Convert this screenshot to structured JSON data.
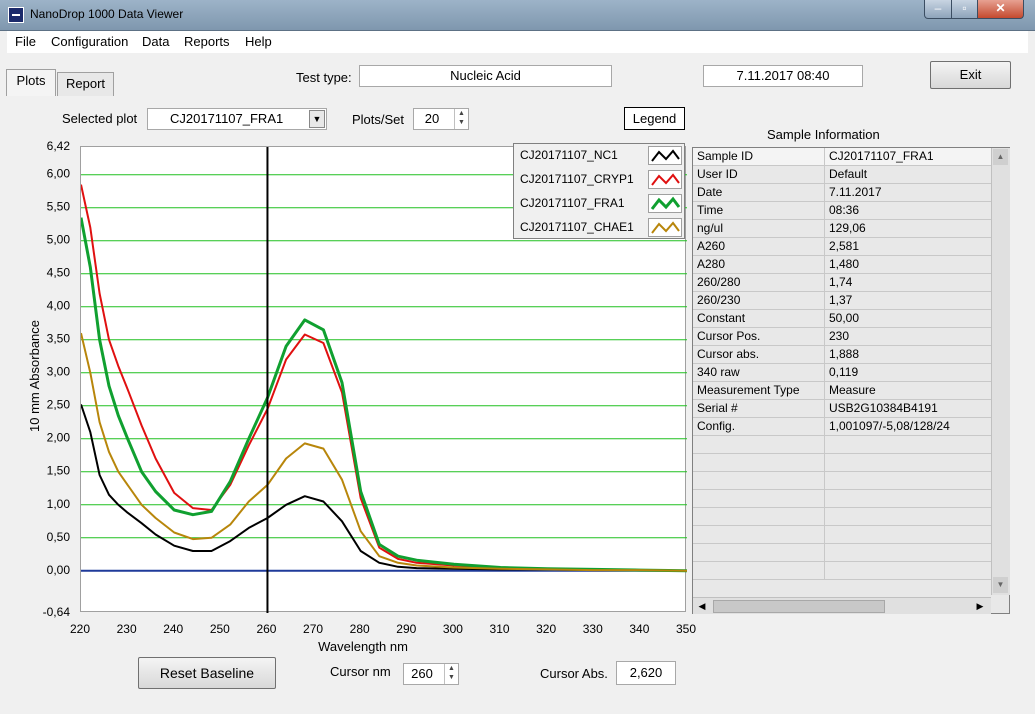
{
  "titlebar": {
    "title": "NanoDrop 1000 Data Viewer",
    "min_label": "–",
    "max_label": "▫",
    "close_label": "✕"
  },
  "menu": [
    {
      "label": "File"
    },
    {
      "label": "Configuration"
    },
    {
      "label": "Data"
    },
    {
      "label": "Reports"
    },
    {
      "label": "Help"
    }
  ],
  "tabs": [
    {
      "label": "Plots"
    },
    {
      "label": "Report"
    }
  ],
  "test_type": {
    "label": "Test type:",
    "value": "Nucleic Acid"
  },
  "datetime": "7.11.2017  08:40",
  "exit_label": "Exit",
  "selected_plot": {
    "label": "Selected plot",
    "value": "CJ20171107_FRA1"
  },
  "plots_per_set": {
    "label": "Plots/Set",
    "value": "20"
  },
  "legend_button": "Legend",
  "sample_info_title": "Sample Information",
  "sample_info": [
    {
      "key": "Sample ID",
      "value": "CJ20171107_FRA1"
    },
    {
      "key": "User ID",
      "value": "Default"
    },
    {
      "key": "Date",
      "value": "7.11.2017"
    },
    {
      "key": "Time",
      "value": "08:36"
    },
    {
      "key": "ng/ul",
      "value": "129,06"
    },
    {
      "key": "A260",
      "value": " 2,581"
    },
    {
      "key": "A280",
      "value": " 1,480"
    },
    {
      "key": "260/280",
      "value": " 1,74"
    },
    {
      "key": "260/230",
      "value": " 1,37"
    },
    {
      "key": "Constant",
      "value": "50,00"
    },
    {
      "key": "Cursor Pos.",
      "value": "230"
    },
    {
      "key": "Cursor abs.",
      "value": "1,888"
    },
    {
      "key": "340 raw",
      "value": " 0,119"
    },
    {
      "key": "Measurement Type",
      "value": "Measure"
    },
    {
      "key": "Serial #",
      "value": "USB2G10384B4191"
    },
    {
      "key": "Config.",
      "value": "1,001097/-5,08/128/24"
    }
  ],
  "reset_baseline": "Reset Baseline",
  "cursor_nm": {
    "label": "Cursor nm",
    "value": "260"
  },
  "cursor_abs": {
    "label": "Cursor Abs.",
    "value": "2,620"
  },
  "chart_data": {
    "type": "line",
    "xlabel": "Wavelength nm",
    "ylabel": "10 mm Absorbance",
    "xlim": [
      220,
      350
    ],
    "ylim": [
      -0.64,
      6.42
    ],
    "x_ticks": [
      "220",
      "230",
      "240",
      "250",
      "260",
      "270",
      "280",
      "290",
      "300",
      "310",
      "320",
      "330",
      "340",
      "350"
    ],
    "y_ticks": [
      {
        "v": 6.42,
        "label": "6,42"
      },
      {
        "v": 6.0,
        "label": "6,00"
      },
      {
        "v": 5.5,
        "label": "5,50"
      },
      {
        "v": 5.0,
        "label": "5,00"
      },
      {
        "v": 4.5,
        "label": "4,50"
      },
      {
        "v": 4.0,
        "label": "4,00"
      },
      {
        "v": 3.5,
        "label": "3,50"
      },
      {
        "v": 3.0,
        "label": "3,00"
      },
      {
        "v": 2.5,
        "label": "2,50"
      },
      {
        "v": 2.0,
        "label": "2,00"
      },
      {
        "v": 1.5,
        "label": "1,50"
      },
      {
        "v": 1.0,
        "label": "1,00"
      },
      {
        "v": 0.5,
        "label": "0,50"
      },
      {
        "v": 0.0,
        "label": "0,00"
      },
      {
        "v": -0.64,
        "label": "-0,64"
      }
    ],
    "grid": true,
    "cursor_x": 260,
    "baseline_color": "#1f3a9a",
    "x": [
      220,
      222,
      224,
      226,
      228,
      230,
      233,
      236,
      240,
      244,
      248,
      252,
      256,
      260,
      264,
      268,
      272,
      276,
      280,
      284,
      288,
      292,
      300,
      310,
      320,
      330,
      340,
      350
    ],
    "series": [
      {
        "name": "CJ20171107_NC1",
        "color": "#000000",
        "values": [
          2.52,
          2.1,
          1.45,
          1.15,
          1.0,
          0.88,
          0.72,
          0.55,
          0.38,
          0.3,
          0.3,
          0.45,
          0.65,
          0.8,
          1.0,
          1.13,
          1.05,
          0.75,
          0.3,
          0.12,
          0.06,
          0.04,
          0.03,
          0.02,
          0.02,
          0.01,
          0.01,
          0.0
        ]
      },
      {
        "name": "CJ20171107_CRYP1",
        "color": "#e01010",
        "values": [
          5.85,
          5.2,
          4.2,
          3.5,
          3.1,
          2.75,
          2.2,
          1.7,
          1.18,
          0.95,
          0.92,
          1.3,
          1.9,
          2.45,
          3.2,
          3.58,
          3.45,
          2.7,
          1.1,
          0.35,
          0.18,
          0.12,
          0.08,
          0.04,
          0.03,
          0.02,
          0.01,
          0.0
        ]
      },
      {
        "name": "CJ20171107_FRA1",
        "color": "#10a030",
        "values": [
          5.35,
          4.6,
          3.5,
          2.8,
          2.35,
          2.0,
          1.5,
          1.2,
          0.92,
          0.85,
          0.9,
          1.35,
          2.0,
          2.62,
          3.4,
          3.8,
          3.65,
          2.85,
          1.2,
          0.4,
          0.22,
          0.16,
          0.1,
          0.05,
          0.03,
          0.02,
          0.01,
          0.0
        ]
      },
      {
        "name": "CJ20171107_CHAE1",
        "color": "#b8860b",
        "values": [
          3.6,
          3.0,
          2.25,
          1.8,
          1.5,
          1.3,
          1.0,
          0.8,
          0.58,
          0.48,
          0.5,
          0.7,
          1.05,
          1.3,
          1.7,
          1.93,
          1.85,
          1.38,
          0.6,
          0.22,
          0.12,
          0.08,
          0.05,
          0.03,
          0.02,
          0.01,
          0.01,
          0.0
        ]
      }
    ]
  }
}
